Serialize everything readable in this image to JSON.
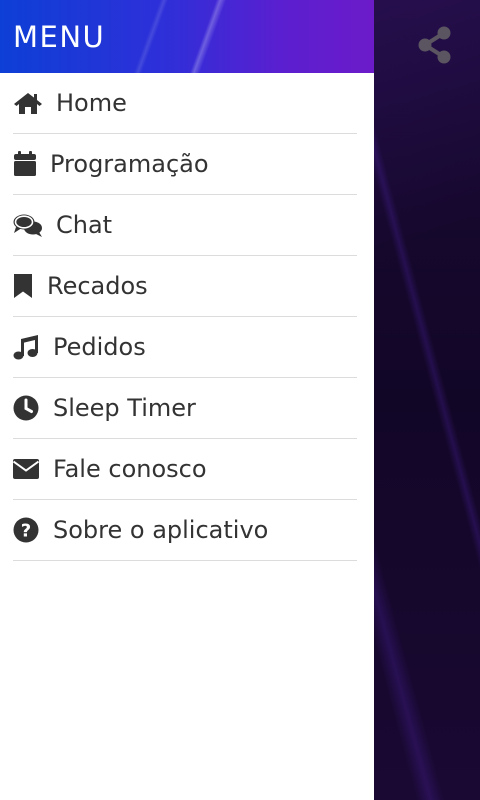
{
  "drawer": {
    "title": "MENU",
    "items": [
      {
        "label": "Home",
        "icon": "home-icon"
      },
      {
        "label": "Programação",
        "icon": "calendar-icon"
      },
      {
        "label": "Chat",
        "icon": "chat-icon"
      },
      {
        "label": "Recados",
        "icon": "bookmark-icon"
      },
      {
        "label": "Pedidos",
        "icon": "music-note-icon"
      },
      {
        "label": "Sleep Timer",
        "icon": "clock-icon"
      },
      {
        "label": "Fale conosco",
        "icon": "envelope-icon"
      },
      {
        "label": "Sobre o aplicativo",
        "icon": "question-circle-icon"
      }
    ]
  },
  "header_actions": {
    "share_icon": "share-icon"
  },
  "colors": {
    "header_gradient_start": "#0d3fd6",
    "header_gradient_end": "#6c1bc9",
    "drawer_bg": "#ffffff",
    "text": "#333333",
    "divider": "#dcdcdc",
    "app_bg": "#120627"
  }
}
